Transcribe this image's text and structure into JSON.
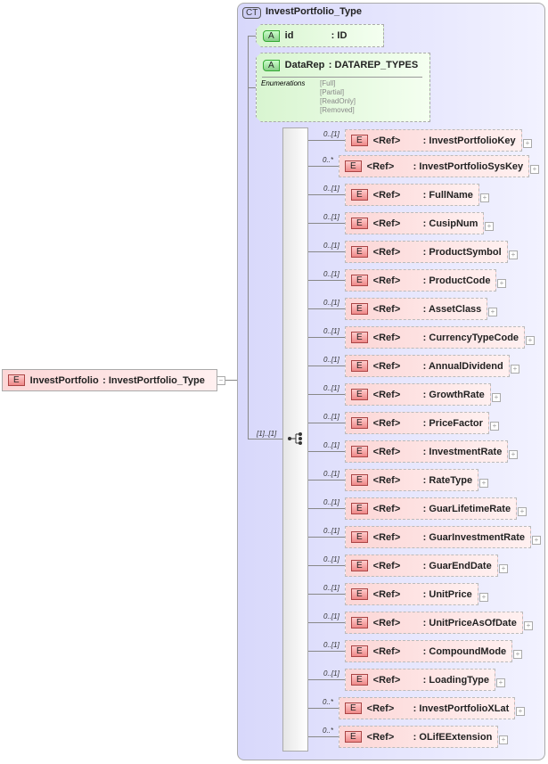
{
  "root": {
    "badge": "E",
    "name": "InvestPortfolio",
    "type": ": InvestPortfolio_Type",
    "expander": "−"
  },
  "complex_type": {
    "badge": "CT",
    "name": "InvestPortfolio_Type"
  },
  "attributes": [
    {
      "badge": "A",
      "name": "id",
      "type": ": ID"
    },
    {
      "badge": "A",
      "name": "DataRep",
      "type": ": DATAREP_TYPES",
      "enum_label": "Enumerations",
      "enums": [
        "[Full]",
        "[Partial]",
        "[ReadOnly]",
        "[Removed]"
      ]
    }
  ],
  "sequence": {
    "cardinality": "[1]..[1]"
  },
  "elements": [
    {
      "card": "0..[1]",
      "ref": "<Ref>",
      "name": ": InvestPortfolioKey"
    },
    {
      "card": "0..*",
      "ref": "<Ref>",
      "name": ": InvestPortfolioSysKey"
    },
    {
      "card": "0..[1]",
      "ref": "<Ref>",
      "name": ": FullName"
    },
    {
      "card": "0..[1]",
      "ref": "<Ref>",
      "name": ": CusipNum"
    },
    {
      "card": "0..[1]",
      "ref": "<Ref>",
      "name": ": ProductSymbol"
    },
    {
      "card": "0..[1]",
      "ref": "<Ref>",
      "name": ": ProductCode"
    },
    {
      "card": "0..[1]",
      "ref": "<Ref>",
      "name": ": AssetClass"
    },
    {
      "card": "0..[1]",
      "ref": "<Ref>",
      "name": ": CurrencyTypeCode"
    },
    {
      "card": "0..[1]",
      "ref": "<Ref>",
      "name": ": AnnualDividend"
    },
    {
      "card": "0..[1]",
      "ref": "<Ref>",
      "name": ": GrowthRate"
    },
    {
      "card": "0..[1]",
      "ref": "<Ref>",
      "name": ": PriceFactor"
    },
    {
      "card": "0..[1]",
      "ref": "<Ref>",
      "name": ": InvestmentRate"
    },
    {
      "card": "0..[1]",
      "ref": "<Ref>",
      "name": ": RateType"
    },
    {
      "card": "0..[1]",
      "ref": "<Ref>",
      "name": ": GuarLifetimeRate"
    },
    {
      "card": "0..[1]",
      "ref": "<Ref>",
      "name": ": GuarInvestmentRate"
    },
    {
      "card": "0..[1]",
      "ref": "<Ref>",
      "name": ": GuarEndDate"
    },
    {
      "card": "0..[1]",
      "ref": "<Ref>",
      "name": ": UnitPrice"
    },
    {
      "card": "0..[1]",
      "ref": "<Ref>",
      "name": ": UnitPriceAsOfDate"
    },
    {
      "card": "0..[1]",
      "ref": "<Ref>",
      "name": ": CompoundMode"
    },
    {
      "card": "0..[1]",
      "ref": "<Ref>",
      "name": ": LoadingType"
    },
    {
      "card": "0..*",
      "ref": "<Ref>",
      "name": ": InvestPortfolioXLat"
    },
    {
      "card": "0..*",
      "ref": "<Ref>",
      "name": ": OLifEExtension"
    }
  ],
  "element_badge": "E",
  "expander": "+"
}
